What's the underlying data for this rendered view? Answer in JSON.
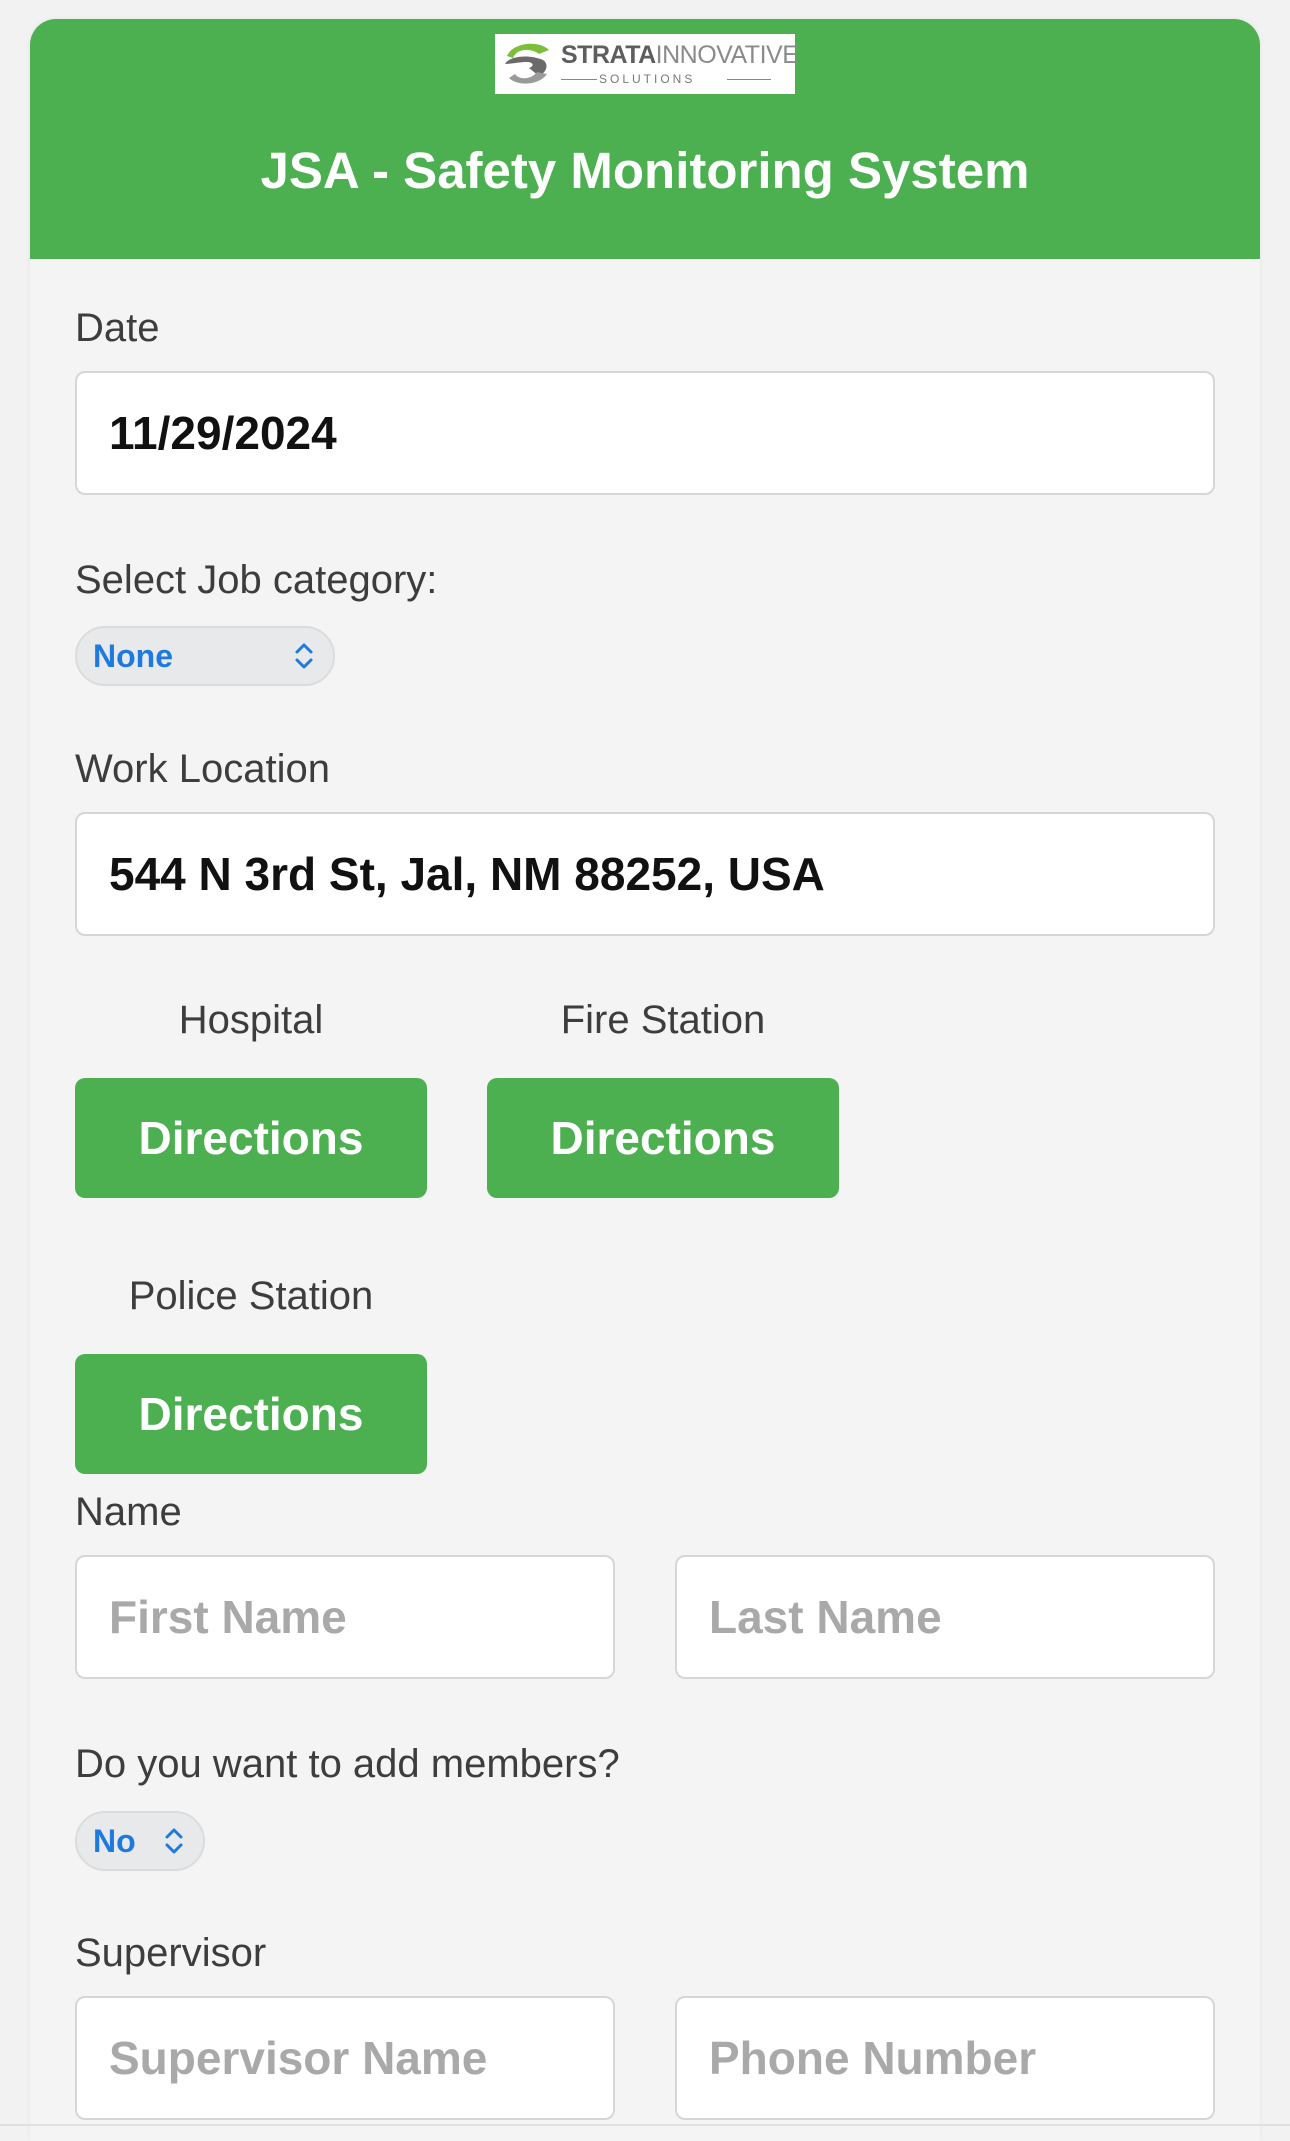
{
  "header": {
    "logo_text_bold": "STRATA",
    "logo_text_light": "INNOVATIVE",
    "logo_subtext": "SOLUTIONS",
    "title": "JSA - Safety Monitoring System"
  },
  "form": {
    "date": {
      "label": "Date",
      "value": "11/29/2024"
    },
    "job_category": {
      "label": "Select Job category:",
      "selected": "None"
    },
    "work_location": {
      "label": "Work Location",
      "value": "544 N 3rd St, Jal, NM 88252, USA"
    },
    "hospital": {
      "label": "Hospital",
      "button": "Directions"
    },
    "fire_station": {
      "label": "Fire Station",
      "button": "Directions"
    },
    "police_station": {
      "label": "Police Station",
      "button": "Directions"
    },
    "name": {
      "label": "Name",
      "first_placeholder": "First Name",
      "last_placeholder": "Last Name"
    },
    "add_members": {
      "label": "Do you want to add members?",
      "selected": "No"
    },
    "supervisor": {
      "label": "Supervisor",
      "name_placeholder": "Supervisor Name",
      "phone_placeholder": "Phone Number"
    }
  },
  "colors": {
    "brand_green": "#4caf50",
    "select_blue": "#1f7ae0"
  }
}
